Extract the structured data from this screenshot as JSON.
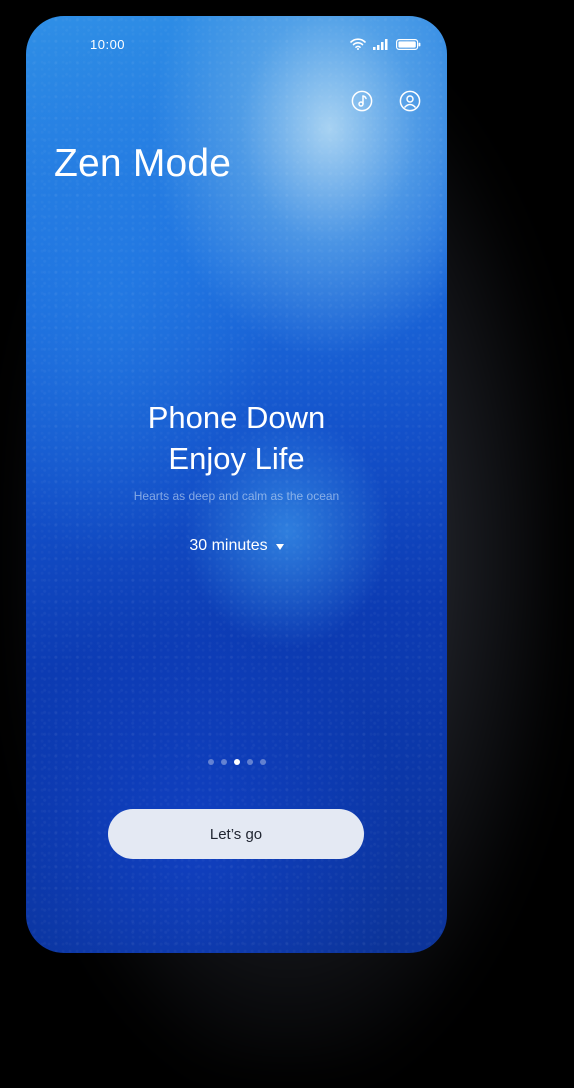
{
  "status_bar": {
    "time": "10:00"
  },
  "header": {
    "title": "Zen Mode",
    "icons": [
      "music-note-icon",
      "profile-icon"
    ]
  },
  "hero": {
    "line1": "Phone Down",
    "line2": "Enjoy Life",
    "subtitle": "Hearts as deep and calm as the ocean"
  },
  "duration": {
    "selected": "30 minutes"
  },
  "pager": {
    "total": 5,
    "active_index": 2
  },
  "cta": {
    "label": "Let’s go"
  },
  "colors": {
    "background_top": "#2f8fe6",
    "background_bottom": "#0c3499",
    "button_bg": "#e4e9f3",
    "button_text": "#1f2430"
  }
}
